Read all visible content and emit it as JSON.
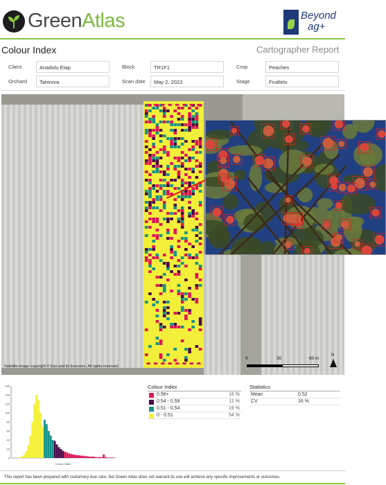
{
  "brand": {
    "name_part1": "Green",
    "name_part2": "Atlas",
    "partner_line1": "Beyond",
    "partner_line2": "ag+"
  },
  "report": {
    "title": "Colour Index",
    "type": "Cartographer Report"
  },
  "meta": {
    "client_label": "Client",
    "client_value": "Anadolu Etap",
    "block_label": "Block",
    "block_value": "TR1F1",
    "crop_label": "Crop",
    "crop_value": "Peaches",
    "orchard_label": "Orchard",
    "orchard_value": "Tahirova",
    "scan_date_label": "Scan date",
    "scan_date_value": "May 2, 2023",
    "stage_label": "Stage",
    "stage_value": "Fruitlets"
  },
  "map": {
    "copyright": "Satellite image copyright © Esri and its licensors. All rights reserved.",
    "scale_ticks": [
      "0",
      "30",
      "60 m"
    ],
    "north_label": "N"
  },
  "legend": {
    "title": "Colour Index",
    "items": [
      {
        "range": "0.58+",
        "percent": "16 %",
        "color": "#e0155a"
      },
      {
        "range": "0.54 - 0.58",
        "percent": "11 %",
        "color": "#4a0a4a"
      },
      {
        "range": "0.51 - 0.54",
        "percent": "19 %",
        "color": "#15938a"
      },
      {
        "range": "0 - 0.51",
        "percent": "54 %",
        "color": "#f2f03a"
      }
    ]
  },
  "statistics": {
    "title": "Statistics",
    "mean_label": "Mean",
    "mean_value": "0.52",
    "cv_label": "CV",
    "cv_value": "16 %"
  },
  "chart_data": {
    "type": "bar",
    "y_ticks": [
      "0",
      "20",
      "40",
      "60",
      "80",
      "100",
      "120",
      "140",
      "160"
    ],
    "ylim": [
      0,
      160
    ],
    "xlabel": "Colour Index",
    "segments": [
      {
        "color": "#f2f03a",
        "values": [
          0,
          0,
          0,
          1,
          2,
          4,
          8,
          15,
          28,
          50,
          80,
          120,
          140,
          128,
          100,
          70
        ]
      },
      {
        "color": "#15938a",
        "values": [
          85,
          75,
          60,
          50,
          40
        ]
      },
      {
        "color": "#4a0a4a",
        "values": [
          38,
          30,
          24,
          20,
          16
        ]
      },
      {
        "color": "#e0155a",
        "values": [
          14,
          12,
          10,
          9,
          8,
          7,
          6,
          6,
          5,
          5,
          4,
          4,
          3,
          3,
          3,
          2,
          2,
          2,
          2,
          8,
          2,
          1,
          1,
          1,
          1
        ]
      }
    ]
  },
  "footer": {
    "disclaimer": "This report has been prepared with customary due care, but Green Atlas does not warrant its use will achieve any specific improvements or outcomes."
  }
}
